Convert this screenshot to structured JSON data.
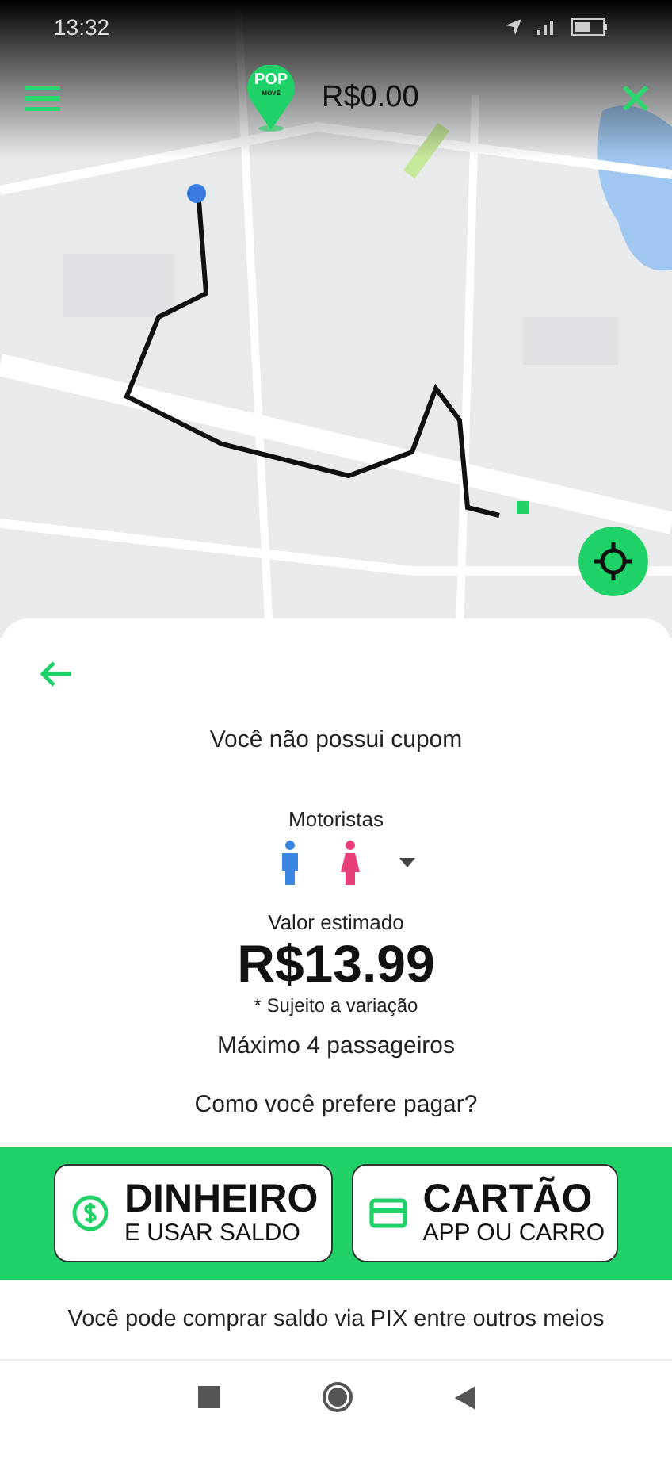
{
  "status_bar": {
    "time": "13:32"
  },
  "top_bar": {
    "logo": {
      "title": "POP",
      "subtitle": "MOVE"
    },
    "balance": "R$0.00"
  },
  "trip": {
    "coupon_message": "Você não possui cupom",
    "drivers_label": "Motoristas",
    "estimate_label": "Valor estimado",
    "price": "R$13.99",
    "price_note": "* Sujeito a variação",
    "capacity": "Máximo 4 passageiros",
    "payment_question": "Como você prefere pagar?"
  },
  "payment_options": [
    {
      "kind": "cash",
      "title": "DINHEIRO",
      "subtitle": "E USAR SALDO"
    },
    {
      "kind": "card",
      "title": "CARTÃO",
      "subtitle": "APP OU CARRO"
    }
  ],
  "footer_note": "Você pode comprar saldo via PIX entre outros meios"
}
